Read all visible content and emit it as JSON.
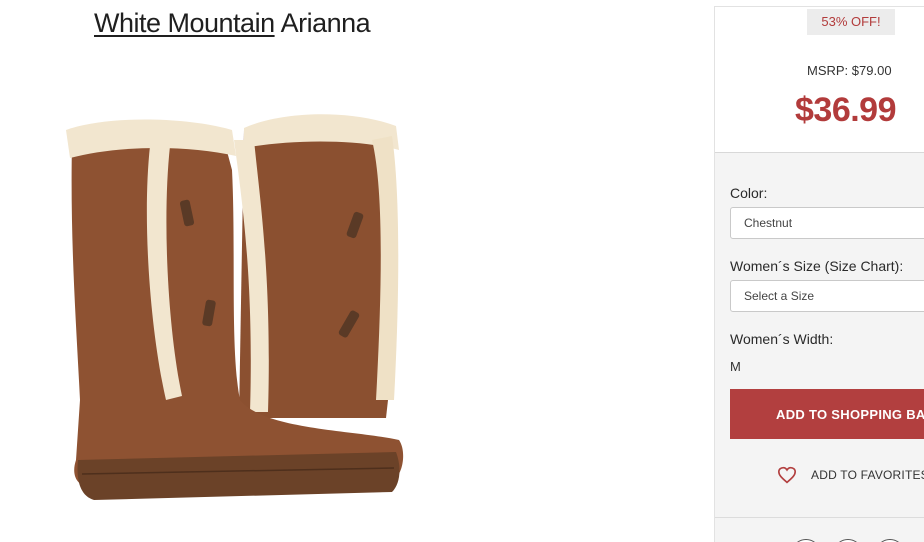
{
  "product": {
    "brand": "White Mountain",
    "model": "Arianna"
  },
  "pricing": {
    "discount_badge": "53% OFF!",
    "msrp": "MSRP: $79.00",
    "sale_price": "$36.99"
  },
  "options": {
    "color_label": "Color:",
    "color_value": "Chestnut",
    "size_label": "Women´s Size (Size Chart):",
    "size_placeholder": "Select a Size",
    "width_label": "Women´s Width:",
    "width_value": "M"
  },
  "actions": {
    "add_to_bag": "ADD TO SHOPPING BAG",
    "add_to_favorites": "ADD TO FAVORITES"
  },
  "colors": {
    "accent_red": "#b23f3f",
    "boot_suede": "#8b5030",
    "fur": "#f2e6cf"
  },
  "icons": {
    "favorite": "heart-outline-icon"
  }
}
